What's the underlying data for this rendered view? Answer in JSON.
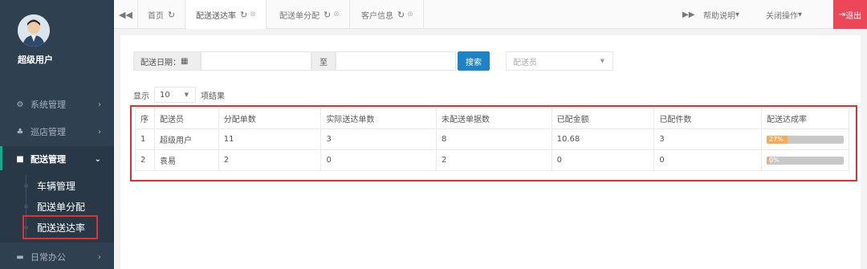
{
  "user": {
    "name": "超级用户"
  },
  "sidebar": {
    "items": [
      {
        "label": "系统管理",
        "icon": "gears-icon"
      },
      {
        "label": "巡店管理",
        "icon": "sitemap-icon"
      },
      {
        "label": "配送管理",
        "icon": "truck-icon"
      },
      {
        "label": "日常办公",
        "icon": "briefcase-icon"
      }
    ],
    "submenu": [
      "车辆管理",
      "配送单分配",
      "配送送达率"
    ]
  },
  "tabs": [
    {
      "label": "首页"
    },
    {
      "label": "配送送达率"
    },
    {
      "label": "配送单分配"
    },
    {
      "label": "客户信息"
    }
  ],
  "topbar": {
    "help": "帮助说明",
    "close_ops": "关闭操作",
    "logout": "退出"
  },
  "filter": {
    "date_label": "配送日期：",
    "to_label": "至",
    "search_label": "搜索",
    "courier_placeholder": "配送员"
  },
  "length": {
    "prefix": "显示",
    "value": "10",
    "suffix": "项结果"
  },
  "table": {
    "headers": [
      "序",
      "配送员",
      "分配单数",
      "实际送达单数",
      "未配送单据数",
      "已配金额",
      "已配件数",
      "配送达成率"
    ],
    "rows": [
      {
        "idx": "1",
        "courier": "超级用户",
        "assigned": "11",
        "delivered": "3",
        "undelivered": "8",
        "amount": "10.68",
        "pieces": "3",
        "rate_text": "27%",
        "rate": 27
      },
      {
        "idx": "2",
        "courier": "袁易",
        "assigned": "2",
        "delivered": "0",
        "undelivered": "2",
        "amount": "0",
        "pieces": "0",
        "rate_text": "0%",
        "rate": 0
      }
    ]
  },
  "colors": {
    "sidebar": "#2f4050",
    "accent": "#1c84c6",
    "progress": "#f8ac59",
    "danger": "#ec4758",
    "highlight": "#e0312f"
  }
}
